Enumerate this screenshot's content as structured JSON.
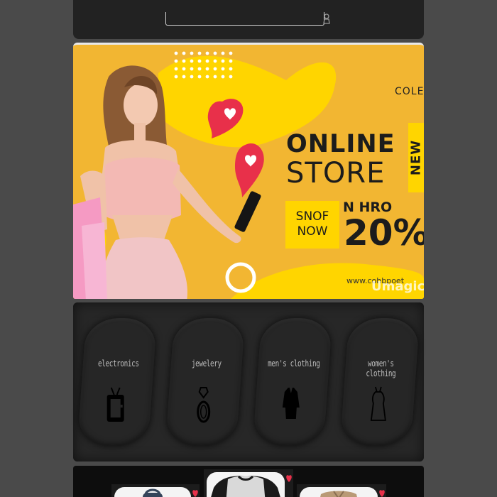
{
  "search": {
    "placeholder": "",
    "value": ""
  },
  "banner": {
    "line1": "COLE",
    "title1": "ONLINE",
    "title2": "STORE",
    "badge": "NEW",
    "cta": "SNOF\nNOW",
    "offer_prefix": "N HRO",
    "offer_value": "20%",
    "url": "www.cohbpoet",
    "watermark": "Umagic",
    "colors": {
      "background": "#f2b632",
      "accent": "#ffd500",
      "heart": "#e8304a"
    }
  },
  "categories": [
    {
      "label": "electronics",
      "icon": "tv-icon"
    },
    {
      "label": "jewelery",
      "icon": "ring-icon"
    },
    {
      "label": "men's clothing",
      "icon": "shirt-icon"
    },
    {
      "label": "women's clothing",
      "icon": "dress-icon"
    }
  ],
  "products": [
    {
      "name": "product-backpack",
      "icon": "heart-icon"
    },
    {
      "name": "product-shirt",
      "icon": "heart-icon"
    },
    {
      "name": "product-jacket",
      "icon": "heart-icon"
    }
  ]
}
